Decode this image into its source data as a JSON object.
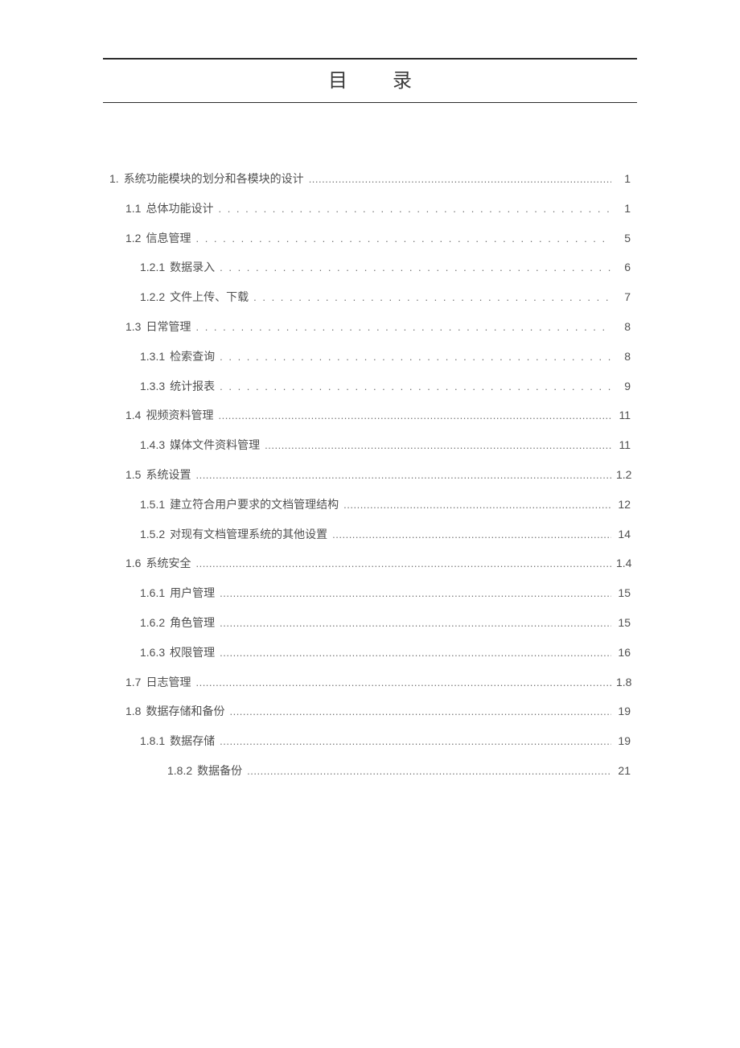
{
  "title": "目录",
  "toc": [
    {
      "level": 1,
      "num": "1.",
      "label": "系统功能模块的划分和各模块的设计",
      "page": "1",
      "leader": "dense"
    },
    {
      "level": 2,
      "num": "1.1",
      "label": "总体功能设计",
      "page": "1",
      "leader": "sparse"
    },
    {
      "level": 2,
      "num": "1.2",
      "label": "信息管理",
      "page": "5",
      "leader": "sparse"
    },
    {
      "level": 3,
      "num": "1.2.1",
      "label": "数据录入",
      "page": "6",
      "leader": "sparse"
    },
    {
      "level": 3,
      "num": "1.2.2",
      "label": "文件上传、下载",
      "page": "7",
      "leader": "sparse"
    },
    {
      "level": 2,
      "num": "1.3",
      "label": "日常管理",
      "page": "8",
      "leader": "sparse"
    },
    {
      "level": 3,
      "num": "1.3.1",
      "label": "检索查询",
      "page": "8",
      "leader": "sparse"
    },
    {
      "level": 3,
      "num": "1.3.3",
      "label": "统计报表",
      "page": "9",
      "leader": "sparse"
    },
    {
      "level": 2,
      "num": "1.4",
      "label": "视频资料管理",
      "page": "11",
      "leader": "dense"
    },
    {
      "level": 3,
      "num": "1.4.3",
      "label": "媒体文件资料管理",
      "page": "11",
      "leader": "dense"
    },
    {
      "level": 2,
      "num": "1.5",
      "label": "系统设置",
      "page": "1.2",
      "leader": "dense"
    },
    {
      "level": 3,
      "num": "1.5.1",
      "label": "建立符合用户要求的文档管理结构",
      "page": "12",
      "leader": "dense"
    },
    {
      "level": 3,
      "num": "1.5.2",
      "label": "对现有文档管理系统的其他设置",
      "page": "14",
      "leader": "dense"
    },
    {
      "level": 2,
      "num": "1.6",
      "label": "系统安全",
      "page": "1.4",
      "leader": "dense"
    },
    {
      "level": 3,
      "num": "1.6.1",
      "label": "用户管理",
      "page": "15",
      "leader": "dense"
    },
    {
      "level": 3,
      "num": "1.6.2",
      "label": "角色管理",
      "page": "15",
      "leader": "dense"
    },
    {
      "level": 3,
      "num": "1.6.3",
      "label": "权限管理",
      "page": "16",
      "leader": "dense"
    },
    {
      "level": 2,
      "num": "1.7",
      "label": "日志管理",
      "page": "1.8",
      "leader": "dense"
    },
    {
      "level": 2,
      "num": "1.8",
      "label": "数据存储和备份",
      "page": "19",
      "leader": "dense"
    },
    {
      "level": 3,
      "num": "1.8.1",
      "label": "数据存储",
      "page": "19",
      "leader": "dense"
    },
    {
      "level": 4,
      "num": "1.8.2",
      "label": "数据备份",
      "page": "21",
      "leader": "dense"
    }
  ]
}
